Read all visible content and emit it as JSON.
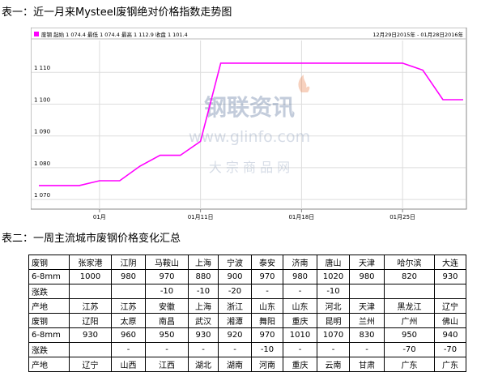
{
  "headings": {
    "chart": "表一：近一月来Mysteel废钢绝对价格指数走势图",
    "table": "表二：一周主流城市废钢价格变化汇总"
  },
  "chart_data": {
    "type": "line",
    "legend_text": "废钢 起始 1 074.4 最低 1 074.4 最高 1 112.9 收盘 1 101.4",
    "date_range": "12月29日2015年 - 01月28日2016年",
    "x_tick_labels": [
      "01月",
      "01月11日",
      "01月18日",
      "01月25日"
    ],
    "x_tick_positions": [
      3,
      8,
      13,
      18
    ],
    "y_ticks": [
      1070,
      1080,
      1090,
      1100,
      1110
    ],
    "y_tick_labels": [
      "1 070",
      "1 080",
      "1 090",
      "1 100",
      "1 110"
    ],
    "ylim": [
      1068,
      1120
    ],
    "xlim": [
      0,
      21
    ],
    "grid": true,
    "line_color": "#ff00ff",
    "series": [
      {
        "x": [
          0,
          2,
          3,
          4,
          5,
          6,
          7,
          8,
          9,
          10,
          11,
          12,
          13,
          14,
          15,
          16,
          17,
          18,
          19,
          20,
          21
        ],
        "values": [
          1074.4,
          1074.4,
          1075.9,
          1075.9,
          1080.5,
          1083.9,
          1083.9,
          1088.3,
          1112.9,
          1112.9,
          1112.9,
          1112.9,
          1112.9,
          1112.9,
          1112.9,
          1112.9,
          1112.9,
          1112.9,
          1110.7,
          1101.4,
          1101.4
        ]
      }
    ]
  },
  "watermark": {
    "logo_text": "钢联资讯",
    "url": "www.glinfo.com",
    "tagline": "大 宗 商 品 网"
  },
  "table": {
    "rows": [
      [
        "废钢",
        "张家港",
        "江阴",
        "马鞍山",
        "上海",
        "宁波",
        "泰安",
        "济南",
        "唐山",
        "天津",
        "哈尔滨",
        "大连"
      ],
      [
        "6-8mm",
        "1000",
        "980",
        "970",
        "880",
        "900",
        "970",
        "980",
        "1020",
        "980",
        "820",
        "930"
      ],
      [
        "涨跌",
        "",
        "",
        "-10",
        "-10",
        "-20",
        "-",
        "-",
        "-10",
        "",
        "",
        ""
      ],
      [
        "产地",
        "江苏",
        "江苏",
        "安徽",
        "上海",
        "浙江",
        "山东",
        "山东",
        "河北",
        "天津",
        "黑龙江",
        "辽宁"
      ],
      [
        "废钢",
        "辽阳",
        "太原",
        "南昌",
        "武汉",
        "湘潭",
        "舞阳",
        "重庆",
        "昆明",
        "兰州",
        "广州",
        "佛山"
      ],
      [
        "6-8mm",
        "930",
        "960",
        "950",
        "930",
        "920",
        "970",
        "1010",
        "1070",
        "830",
        "950",
        "940"
      ],
      [
        "涨跌",
        "",
        "-",
        "-",
        "-",
        "-",
        "-10",
        "-",
        "-",
        "-",
        "-70",
        "-70"
      ],
      [
        "产地",
        "辽宁",
        "山西",
        "江西",
        "湖北",
        "湖南",
        "河南",
        "重庆",
        "云南",
        "甘肃",
        "广东",
        "广东"
      ]
    ]
  }
}
